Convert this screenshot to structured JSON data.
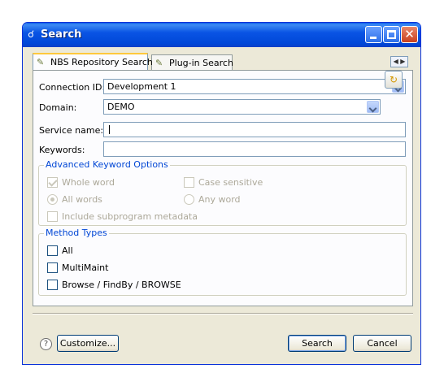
{
  "window": {
    "title": "Search"
  },
  "tabs": [
    {
      "label": "NBS Repository Search",
      "active": true
    },
    {
      "label": "Plug-in Search",
      "active": false
    }
  ],
  "form": {
    "connection_id": {
      "label": "Connection ID:",
      "value": "Development 1"
    },
    "domain": {
      "label": "Domain:",
      "value": "DEMO"
    },
    "service_name": {
      "label": "Service name:",
      "value": ""
    },
    "keywords": {
      "label": "Keywords:",
      "value": ""
    }
  },
  "advanced": {
    "title": "Advanced Keyword Options",
    "whole_word": {
      "label": "Whole word",
      "checked": true,
      "enabled": false
    },
    "case_sensitive": {
      "label": "Case sensitive",
      "checked": false,
      "enabled": false
    },
    "all_words": {
      "label": "All words",
      "checked": true,
      "enabled": false
    },
    "any_word": {
      "label": "Any word",
      "checked": false,
      "enabled": false
    },
    "include_subprogram": {
      "label": "Include subprogram metadata",
      "checked": false,
      "enabled": false
    }
  },
  "method_types": {
    "title": "Method Types",
    "options": [
      {
        "label": "All",
        "checked": false
      },
      {
        "label": "MultiMaint",
        "checked": false
      },
      {
        "label": "Browse / FindBy / BROWSE",
        "checked": false
      }
    ]
  },
  "footer": {
    "help": "?",
    "customize": "Customize...",
    "search": "Search",
    "cancel": "Cancel"
  },
  "colors": {
    "titlebar": "#0054e3",
    "group_title": "#0046d5",
    "dialog_bg": "#ece9d8"
  }
}
